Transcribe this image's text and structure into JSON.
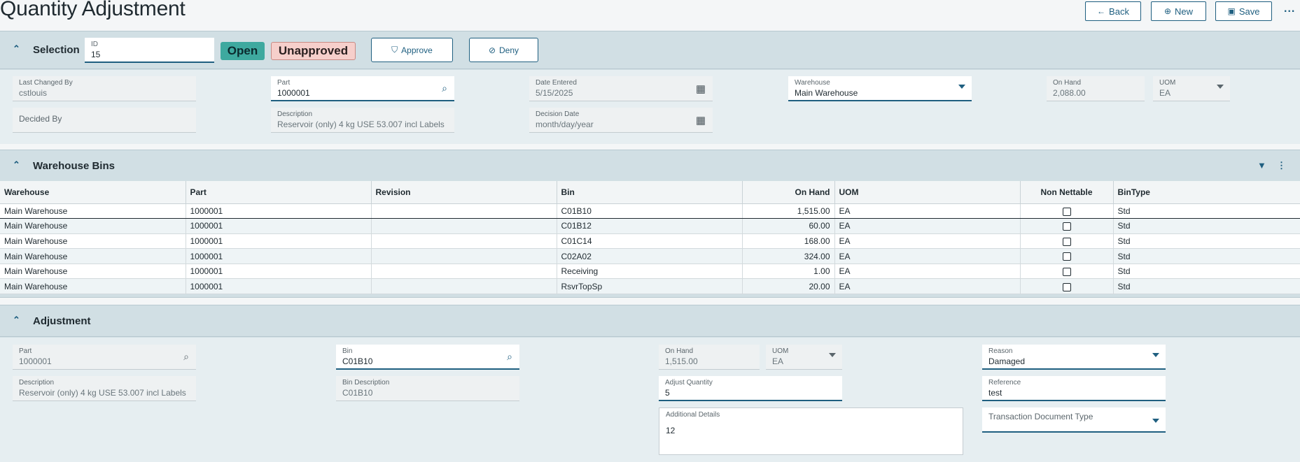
{
  "header": {
    "title": "Quantity Adjustment",
    "back_label": "Back",
    "new_label": "New",
    "save_label": "Save",
    "more_label": "..."
  },
  "selection": {
    "title": "Selection",
    "id_label": "ID",
    "id_value": "15",
    "status_open": "Open",
    "status_approval": "Unapproved",
    "approve_label": "Approve",
    "deny_label": "Deny",
    "last_changed_by_label": "Last Changed By",
    "last_changed_by_value": "cstlouis",
    "decided_by_label": "Decided By",
    "part_label": "Part",
    "part_value": "1000001",
    "description_label": "Description",
    "description_value": "Reservoir (only) 4 kg  USE 53.007  incl Labels",
    "date_entered_label": "Date Entered",
    "date_entered_value": "5/15/2025",
    "decision_date_label": "Decision Date",
    "decision_date_placeholder": "month/day/year",
    "warehouse_label": "Warehouse",
    "warehouse_value": "Main Warehouse",
    "on_hand_label": "On Hand",
    "on_hand_value": "2,088.00",
    "uom_label": "UOM",
    "uom_value": "EA"
  },
  "bins": {
    "title": "Warehouse Bins",
    "columns": [
      "Warehouse",
      "Part",
      "Revision",
      "Bin",
      "On Hand",
      "UOM",
      "Non Nettable",
      "BinType"
    ],
    "rows": [
      [
        "Main Warehouse",
        "1000001",
        "",
        "C01B10",
        "1,515.00",
        "EA",
        "",
        "Std"
      ],
      [
        "Main Warehouse",
        "1000001",
        "",
        "C01B12",
        "60.00",
        "EA",
        "",
        "Std"
      ],
      [
        "Main Warehouse",
        "1000001",
        "",
        "C01C14",
        "168.00",
        "EA",
        "",
        "Std"
      ],
      [
        "Main Warehouse",
        "1000001",
        "",
        "C02A02",
        "324.00",
        "EA",
        "",
        "Std"
      ],
      [
        "Main Warehouse",
        "1000001",
        "",
        "Receiving",
        "1.00",
        "EA",
        "",
        "Std"
      ],
      [
        "Main Warehouse",
        "1000001",
        "",
        "RsvrTopSp",
        "20.00",
        "EA",
        "",
        "Std"
      ]
    ]
  },
  "adjustment": {
    "title": "Adjustment",
    "part_label": "Part",
    "part_value": "1000001",
    "description_label": "Description",
    "description_value": "Reservoir (only) 4 kg  USE 53.007  incl Labels",
    "bin_label": "Bin",
    "bin_value": "C01B10",
    "bin_description_label": "Bin Description",
    "bin_description_value": "C01B10",
    "on_hand_label": "On Hand",
    "on_hand_value": "1,515.00",
    "uom_label": "UOM",
    "uom_value": "EA",
    "adjust_quantity_label": "Adjust Quantity",
    "adjust_quantity_value": "5",
    "additional_details_label": "Additional Details",
    "additional_details_value": "12",
    "reason_label": "Reason",
    "reason_value": "Damaged",
    "reference_label": "Reference",
    "reference_value": "test",
    "transaction_doc_type_label": "Transaction Document Type"
  },
  "colors": {
    "accent": "#1f5f80",
    "open_badge": "#3ea99f",
    "unapproved_badge": "#f6cfcb"
  },
  "icons": [
    "arrow-left-icon",
    "plus-circle-icon",
    "save-icon",
    "more-icon",
    "chevron-up-icon",
    "shield-check-icon",
    "shield-slash-icon",
    "search-icon",
    "calendar-icon",
    "filter-icon",
    "kebab-icon",
    "dropdown-caret-icon"
  ]
}
